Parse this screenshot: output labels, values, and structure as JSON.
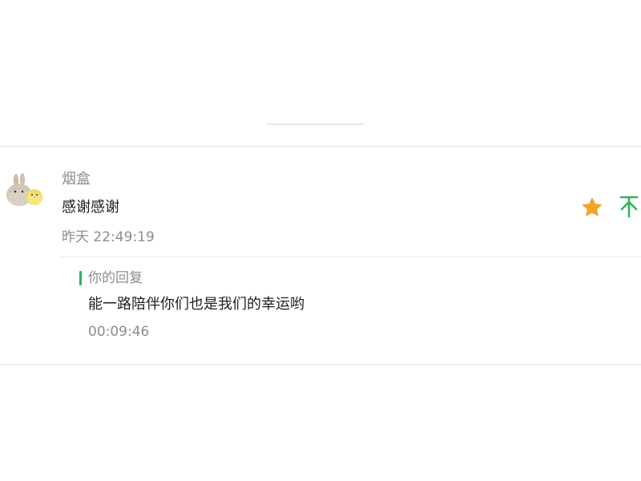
{
  "comment": {
    "author": "烟盒",
    "text": "感谢感谢",
    "time": "昨天 22:49:19"
  },
  "reply": {
    "label": "你的回复",
    "text": "能一路陪伴你们也是我们的幸运哟",
    "time": "00:09:46"
  },
  "actions": {
    "star_icon": "star-icon",
    "pin_icon": "pin-to-top-icon"
  },
  "colors": {
    "accent_green": "#2fb45a",
    "star_orange": "#f2a42a",
    "text_primary": "#1f1f1f",
    "text_secondary": "#8d8d8d"
  }
}
